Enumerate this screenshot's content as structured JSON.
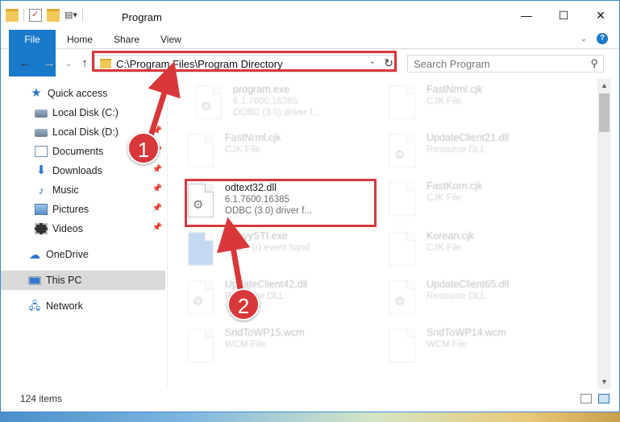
{
  "window": {
    "title": "Program",
    "controls": [
      "—",
      "☐",
      "✕"
    ]
  },
  "ribbon": {
    "tabs": [
      "File",
      "Home",
      "Share",
      "View"
    ]
  },
  "address": {
    "path": "C:\\Program Files\\Program Directory",
    "search_placeholder": "Search Program"
  },
  "nav_pane": {
    "items": [
      {
        "label": "Quick access",
        "icon": "star-icon",
        "pinned": false
      },
      {
        "label": "Local Disk (C:)",
        "icon": "disk-icon",
        "pinned": false
      },
      {
        "label": "Local Disk (D:)",
        "icon": "disk-icon",
        "pinned": true
      },
      {
        "label": "Documents",
        "icon": "documents-icon",
        "pinned": true
      },
      {
        "label": "Downloads",
        "icon": "downloads-icon",
        "pinned": true
      },
      {
        "label": "Music",
        "icon": "music-icon",
        "pinned": true
      },
      {
        "label": "Pictures",
        "icon": "pictures-icon",
        "pinned": true
      },
      {
        "label": "Videos",
        "icon": "videos-icon",
        "pinned": true
      },
      {
        "label": "OneDrive",
        "icon": "onedrive-icon",
        "pinned": false
      },
      {
        "label": "This PC",
        "icon": "this-pc-icon",
        "pinned": false,
        "selected": true
      },
      {
        "label": "Network",
        "icon": "network-icon",
        "pinned": false
      }
    ]
  },
  "files": [
    {
      "name": "program.exe",
      "line1": "6.1.7600.16385",
      "line2": "ODBC (3.0) driver f...",
      "faded": true
    },
    {
      "name": "FastNrml.cjk",
      "line1": "CJK File",
      "line2": "",
      "faded": true
    },
    {
      "name": "FastNrml.cjk",
      "line1": "CJK File",
      "line2": "",
      "faded": true
    },
    {
      "name": "UpdateClient21.dll",
      "line1": "Resource DLL",
      "line2": "",
      "faded": true
    },
    {
      "name": "odtext32.dll",
      "line1": "6.1.7600.16385",
      "line2": "ODBC (3.0) driver f...",
      "faded": false
    },
    {
      "name": "FastKorn.cjk",
      "line1": "CJK File",
      "line2": "",
      "faded": true
    },
    {
      "name": "AbbyySTI.exe",
      "line1": "ABBY (r) event hand",
      "line2": "",
      "faded": true
    },
    {
      "name": "Korean.cjk",
      "line1": "CJK File",
      "line2": "",
      "faded": true
    },
    {
      "name": "UpdateClient42.dll",
      "line1": "Resource DLL",
      "line2": "",
      "faded": true
    },
    {
      "name": "UpdateClient65.dll",
      "line1": "Resource DLL",
      "line2": "",
      "faded": true
    },
    {
      "name": "SndToWP15.wcm",
      "line1": "WCM File",
      "line2": "",
      "faded": true
    },
    {
      "name": "SndToWP14.wcm",
      "line1": "WCM File",
      "line2": "",
      "faded": true
    }
  ],
  "status": {
    "items_count": "124 items"
  },
  "annotations": {
    "badge1": "1",
    "badge2": "2",
    "color": "#d9383a"
  }
}
